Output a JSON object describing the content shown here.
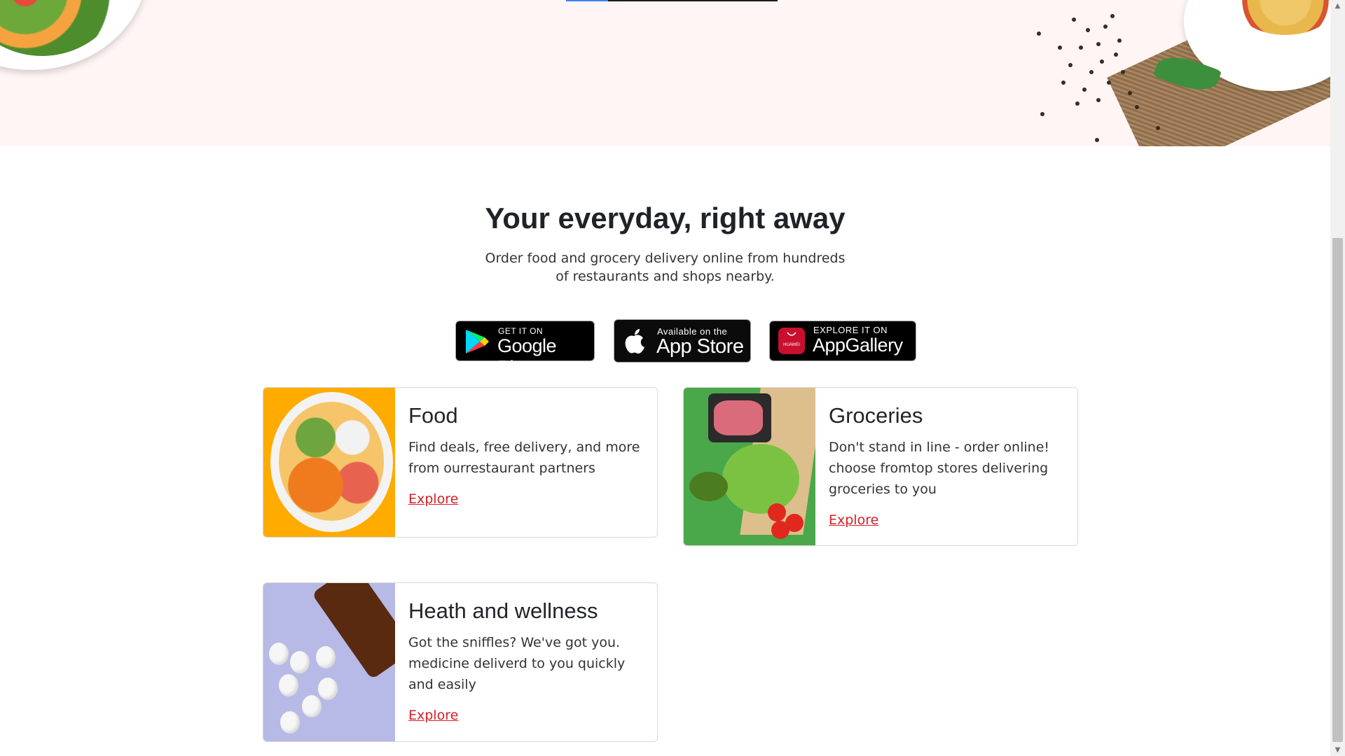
{
  "intro": {
    "heading": "Your everyday, right away",
    "subheading": "Order food and grocery delivery online from hundreds of restaurants and shops nearby."
  },
  "store_badges": {
    "google_play": {
      "small": "GET IT ON",
      "big": "Google Play"
    },
    "app_store": {
      "small": "Available on the",
      "big": "App Store"
    },
    "app_gallery": {
      "small": "EXPLORE IT ON",
      "big": "AppGallery",
      "logo_text": "HUAWEI"
    }
  },
  "cards": {
    "food": {
      "title": "Food",
      "description": "Find deals, free delivery, and more from ourrestaurant partners",
      "link": "Explore"
    },
    "groceries": {
      "title": "Groceries",
      "description": "Don't stand in line - order online! choose fromtop stores delivering groceries to you",
      "link": "Explore"
    },
    "health": {
      "title": "Heath and wellness",
      "description": "Got the sniffles? We've got you. medicine deliverd to you quickly and easily",
      "link": "Explore"
    }
  },
  "colors": {
    "hero_bg": "#fff5f4",
    "link": "#d61f26",
    "food_thumb_bg": "#ffab00",
    "groceries_thumb_bg": "#4aa84a",
    "health_thumb_bg": "#b7b9e6"
  },
  "icons": {
    "google_play": "google-play-triangle-icon",
    "app_store": "apple-icon",
    "app_gallery": "huawei-appgallery-icon",
    "scroll_up": "scroll-up-arrow-icon",
    "scroll_down": "scroll-down-arrow-icon"
  }
}
